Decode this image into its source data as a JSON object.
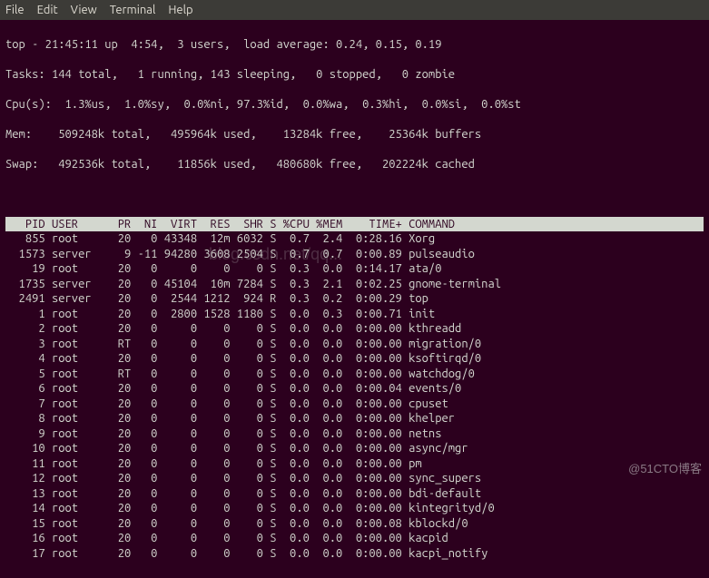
{
  "menubar": [
    "File",
    "Edit",
    "View",
    "Terminal",
    "Help"
  ],
  "summary": {
    "line1": "top - 21:45:11 up  4:54,  3 users,  load average: 0.24, 0.15, 0.19",
    "line2": "Tasks: 144 total,   1 running, 143 sleeping,   0 stopped,   0 zombie",
    "line3": "Cpu(s):  1.3%us,  1.0%sy,  0.0%ni, 97.3%id,  0.0%wa,  0.3%hi,  0.0%si,  0.0%st",
    "line4": "Mem:    509248k total,   495964k used,    13284k free,    25364k buffers",
    "line5": "Swap:   492536k total,    11856k used,   480680k free,   202224k cached"
  },
  "columns": [
    "PID",
    "USER",
    "PR",
    "NI",
    "VIRT",
    "RES",
    "SHR",
    "S",
    "%CPU",
    "%MEM",
    "TIME+",
    "COMMAND"
  ],
  "processes": [
    {
      "pid": "855",
      "user": "root",
      "pr": "20",
      "ni": "0",
      "virt": "43348",
      "res": "12m",
      "shr": "6032",
      "s": "S",
      "cpu": "0.7",
      "mem": "2.4",
      "time": "0:28.16",
      "cmd": "Xorg"
    },
    {
      "pid": "1573",
      "user": "server",
      "pr": "9",
      "ni": "-11",
      "virt": "94280",
      "res": "3608",
      "shr": "2504",
      "s": "S",
      "cpu": "0.7",
      "mem": "0.7",
      "time": "0:00.89",
      "cmd": "pulseaudio"
    },
    {
      "pid": "19",
      "user": "root",
      "pr": "20",
      "ni": "0",
      "virt": "0",
      "res": "0",
      "shr": "0",
      "s": "S",
      "cpu": "0.3",
      "mem": "0.0",
      "time": "0:14.17",
      "cmd": "ata/0"
    },
    {
      "pid": "1735",
      "user": "server",
      "pr": "20",
      "ni": "0",
      "virt": "45104",
      "res": "10m",
      "shr": "7284",
      "s": "S",
      "cpu": "0.3",
      "mem": "2.1",
      "time": "0:02.25",
      "cmd": "gnome-terminal"
    },
    {
      "pid": "2491",
      "user": "server",
      "pr": "20",
      "ni": "0",
      "virt": "2544",
      "res": "1212",
      "shr": "924",
      "s": "R",
      "cpu": "0.3",
      "mem": "0.2",
      "time": "0:00.29",
      "cmd": "top"
    },
    {
      "pid": "1",
      "user": "root",
      "pr": "20",
      "ni": "0",
      "virt": "2800",
      "res": "1528",
      "shr": "1180",
      "s": "S",
      "cpu": "0.0",
      "mem": "0.3",
      "time": "0:00.71",
      "cmd": "init"
    },
    {
      "pid": "2",
      "user": "root",
      "pr": "20",
      "ni": "0",
      "virt": "0",
      "res": "0",
      "shr": "0",
      "s": "S",
      "cpu": "0.0",
      "mem": "0.0",
      "time": "0:00.00",
      "cmd": "kthreadd"
    },
    {
      "pid": "3",
      "user": "root",
      "pr": "RT",
      "ni": "0",
      "virt": "0",
      "res": "0",
      "shr": "0",
      "s": "S",
      "cpu": "0.0",
      "mem": "0.0",
      "time": "0:00.00",
      "cmd": "migration/0"
    },
    {
      "pid": "4",
      "user": "root",
      "pr": "20",
      "ni": "0",
      "virt": "0",
      "res": "0",
      "shr": "0",
      "s": "S",
      "cpu": "0.0",
      "mem": "0.0",
      "time": "0:00.00",
      "cmd": "ksoftirqd/0"
    },
    {
      "pid": "5",
      "user": "root",
      "pr": "RT",
      "ni": "0",
      "virt": "0",
      "res": "0",
      "shr": "0",
      "s": "S",
      "cpu": "0.0",
      "mem": "0.0",
      "time": "0:00.00",
      "cmd": "watchdog/0"
    },
    {
      "pid": "6",
      "user": "root",
      "pr": "20",
      "ni": "0",
      "virt": "0",
      "res": "0",
      "shr": "0",
      "s": "S",
      "cpu": "0.0",
      "mem": "0.0",
      "time": "0:00.04",
      "cmd": "events/0"
    },
    {
      "pid": "7",
      "user": "root",
      "pr": "20",
      "ni": "0",
      "virt": "0",
      "res": "0",
      "shr": "0",
      "s": "S",
      "cpu": "0.0",
      "mem": "0.0",
      "time": "0:00.00",
      "cmd": "cpuset"
    },
    {
      "pid": "8",
      "user": "root",
      "pr": "20",
      "ni": "0",
      "virt": "0",
      "res": "0",
      "shr": "0",
      "s": "S",
      "cpu": "0.0",
      "mem": "0.0",
      "time": "0:00.00",
      "cmd": "khelper"
    },
    {
      "pid": "9",
      "user": "root",
      "pr": "20",
      "ni": "0",
      "virt": "0",
      "res": "0",
      "shr": "0",
      "s": "S",
      "cpu": "0.0",
      "mem": "0.0",
      "time": "0:00.00",
      "cmd": "netns"
    },
    {
      "pid": "10",
      "user": "root",
      "pr": "20",
      "ni": "0",
      "virt": "0",
      "res": "0",
      "shr": "0",
      "s": "S",
      "cpu": "0.0",
      "mem": "0.0",
      "time": "0:00.00",
      "cmd": "async/mgr"
    },
    {
      "pid": "11",
      "user": "root",
      "pr": "20",
      "ni": "0",
      "virt": "0",
      "res": "0",
      "shr": "0",
      "s": "S",
      "cpu": "0.0",
      "mem": "0.0",
      "time": "0:00.00",
      "cmd": "pm"
    },
    {
      "pid": "12",
      "user": "root",
      "pr": "20",
      "ni": "0",
      "virt": "0",
      "res": "0",
      "shr": "0",
      "s": "S",
      "cpu": "0.0",
      "mem": "0.0",
      "time": "0:00.00",
      "cmd": "sync_supers"
    },
    {
      "pid": "13",
      "user": "root",
      "pr": "20",
      "ni": "0",
      "virt": "0",
      "res": "0",
      "shr": "0",
      "s": "S",
      "cpu": "0.0",
      "mem": "0.0",
      "time": "0:00.00",
      "cmd": "bdi-default"
    },
    {
      "pid": "14",
      "user": "root",
      "pr": "20",
      "ni": "0",
      "virt": "0",
      "res": "0",
      "shr": "0",
      "s": "S",
      "cpu": "0.0",
      "mem": "0.0",
      "time": "0:00.00",
      "cmd": "kintegrityd/0"
    },
    {
      "pid": "15",
      "user": "root",
      "pr": "20",
      "ni": "0",
      "virt": "0",
      "res": "0",
      "shr": "0",
      "s": "S",
      "cpu": "0.0",
      "mem": "0.0",
      "time": "0:00.08",
      "cmd": "kblockd/0"
    },
    {
      "pid": "16",
      "user": "root",
      "pr": "20",
      "ni": "0",
      "virt": "0",
      "res": "0",
      "shr": "0",
      "s": "S",
      "cpu": "0.0",
      "mem": "0.0",
      "time": "0:00.00",
      "cmd": "kacpid"
    },
    {
      "pid": "17",
      "user": "root",
      "pr": "20",
      "ni": "0",
      "virt": "0",
      "res": "0",
      "shr": "0",
      "s": "S",
      "cpu": "0.0",
      "mem": "0.0",
      "time": "0:00.00",
      "cmd": "kacpi_notify"
    }
  ],
  "watermarks": {
    "center": "blog.csdn.net/qq...",
    "corner": "@51CTO博客"
  }
}
